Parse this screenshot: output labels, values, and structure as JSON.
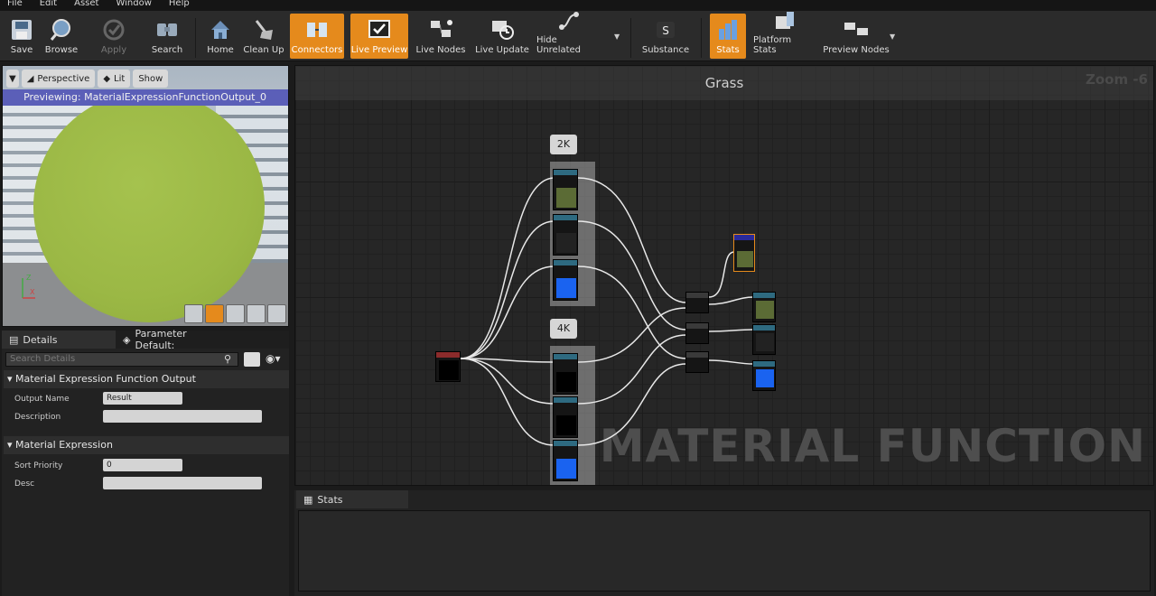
{
  "menu": [
    "File",
    "Edit",
    "Asset",
    "Window",
    "Help"
  ],
  "toolbar": [
    {
      "label": "Save",
      "icon": "save-icon"
    },
    {
      "label": "Browse",
      "icon": "browse-icon"
    },
    {
      "label": "Apply",
      "icon": "apply-icon"
    },
    {
      "label": "Search",
      "icon": "search-icon"
    },
    {
      "label": "Home",
      "icon": "home-icon"
    },
    {
      "label": "Clean Up",
      "icon": "clean-up-icon"
    },
    {
      "label": "Connectors",
      "icon": "connectors-icon"
    },
    {
      "label": "Live Preview",
      "icon": "live-preview-icon"
    },
    {
      "label": "Live Nodes",
      "icon": "live-nodes-icon"
    },
    {
      "label": "Live Update",
      "icon": "live-update-icon"
    },
    {
      "label": "Hide Unrelated",
      "icon": "hide-unrelated-icon"
    },
    {
      "label": "Substance",
      "icon": "substance-icon"
    },
    {
      "label": "Stats",
      "icon": "stats-icon"
    },
    {
      "label": "Platform Stats",
      "icon": "platform-stats-icon"
    },
    {
      "label": "Preview Nodes",
      "icon": "preview-nodes-icon"
    }
  ],
  "viewport": {
    "perspective": "Perspective",
    "lit": "Lit",
    "show": "Show",
    "previewing": "Previewing: MaterialExpressionFunctionOutput_0"
  },
  "details": {
    "tab_details": "Details",
    "tab_params": "Parameter Default:",
    "search_placeholder": "Search Details",
    "section1": "Material Expression Function Output",
    "output_name_label": "Output Name",
    "output_name_value": "Result",
    "description_label": "Description",
    "section2": "Material Expression",
    "sort_priority_label": "Sort Priority",
    "sort_priority_value": "0",
    "desc_label": "Desc"
  },
  "graph": {
    "title": "Grass",
    "zoom": "Zoom -6",
    "watermark": "MATERIAL FUNCTION",
    "comment_2k": "2K",
    "comment_4k": "4K"
  },
  "stats_tab": "Stats",
  "colors": {
    "accent": "#e58a1c",
    "grass": "#9bb845",
    "blue": "#1a63f0"
  }
}
